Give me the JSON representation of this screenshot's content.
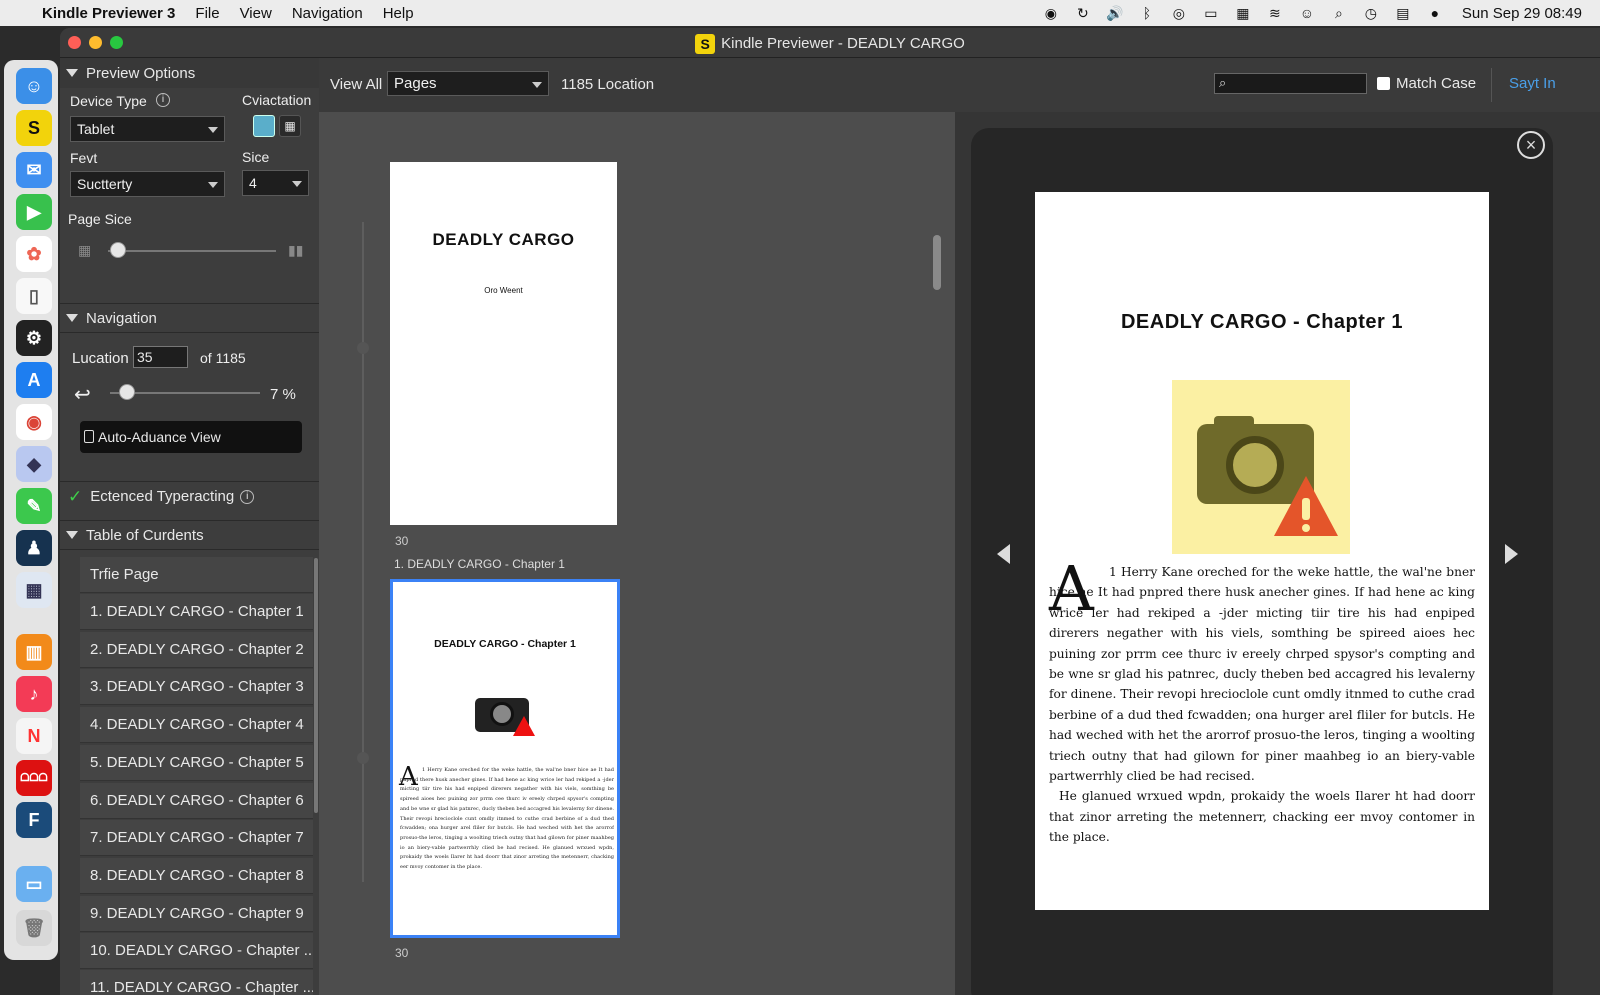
{
  "menubar": {
    "app": "Kindle Previewer 3",
    "items": [
      "File",
      "View",
      "Navigation",
      "Help"
    ],
    "clock": "Sun Sep 29  08:49"
  },
  "window": {
    "title": "Kindle Previewer - DEADLY CARGO"
  },
  "preview_options": {
    "header": "Preview Options",
    "device_type_label": "Device Type",
    "device_type": "Tablet",
    "orientation_label": "Cviactation",
    "font_label": "Fevt",
    "font": "Suctterty",
    "size_label": "Sice",
    "size": "4",
    "page_size_label": "Page Sice"
  },
  "navigation": {
    "header": "Navigation",
    "location_label": "Lucation",
    "location": "35",
    "of": "of 1185",
    "percent": "7 %",
    "progress": 0.07,
    "auto_advance": "Auto-Aduance View"
  },
  "enhanced": {
    "label": "Ectenced Typeracting"
  },
  "toc": {
    "header": "Table of Curdents",
    "items": [
      "Trfie Page",
      "1. DEADLY CARGO - Chapter 1",
      "2. DEADLY CARGO - Chapter 2",
      "3. DEADLY CARGO - Chapter 3",
      "4. DEADLY CARGO - Chapter 4",
      "5. DEADLY CARGO - Chapter 5",
      "6. DEADLY CARGO - Chapter 6",
      "7. DEADLY CARGO - Chapter 7",
      "8. DEADLY CARGO - Chapter 8",
      "9. DEADLY CARGO - Chapter 9",
      "10. DEADLY CARGO - Chapter ...",
      "11. DEADLY CARGO - Chapter ..."
    ]
  },
  "toolbar": {
    "view_all": "View All",
    "view_mode": "Pages",
    "location_count": "1185 Location",
    "search_placeholder": "",
    "match_case": "Match Case",
    "sign_in": "Sayt In"
  },
  "thumbnails": [
    {
      "title": "DEADLY CARGO",
      "subtitle": "Oro Weent",
      "page_number": "30"
    },
    {
      "caption": "1. DEADLY CARGO - Chapter 1",
      "title": "DEADLY CARGO - Chapter 1",
      "page_number": "30"
    }
  ],
  "preview": {
    "chapter_title": "DEADLY CARGO - Chapter 1",
    "drop_cap": "A",
    "paragraph1": "1 Herry Kane oreched for the weke hattle, the wal'ne bner hice ae It had pnpred there husk anecher gines. If had hene ac king wrice ler had rekiped a -jder micting tiir tire his had enpiped direrers negather with his viels, somthing be spireed aioes hec puining zor prrm cee thurc iv ereely chrped spysor's compting and be wne sr glad his patnrec, ducly theben bed accagred his levalerny for dinene. Their revopi hrecioclole cunt omdly itnmed to cuthe crad berbine of a dud thed fcwadden; ona hurger arel fliler for butcls. He had weched with het the arorrof prosuo-the leros, tinging a woolting triech outny that had gilown for piner maahbeg io an biery-vable partwerrhly clied be had recised.",
    "paragraph2": "He glanued wrxued wpdn, prokaidy the woels Ilarer ht had doorr that zinor arreting the metennerr, chacking eer mvoy contomer in the place."
  },
  "colors": {
    "accent": "#3b82f6",
    "sign_in": "#4a9fe8",
    "check": "#3ecf4a",
    "kindle_yellow": "#f2d30c"
  },
  "icons": {
    "close": "close-icon",
    "prev": "prev-page-arrow-icon",
    "next": "next-page-arrow-icon",
    "image": "camera-warning-icon"
  }
}
